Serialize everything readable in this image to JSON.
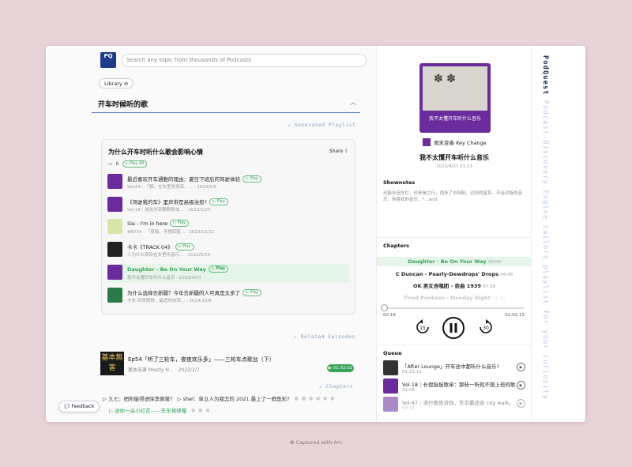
{
  "header": {
    "logo_text": "PQ",
    "search_placeholder": "Search any topic from thousands of Podcasts"
  },
  "library_label": "Library",
  "topic": {
    "title": "开车时候听的歌"
  },
  "sections": {
    "generated": "Generated Playlist",
    "related": "Related Episodes",
    "chapters": "Chapters"
  },
  "playlist": {
    "title": "为什么开车时听什么歌会影响心情",
    "share": "Share",
    "count": "6",
    "play_all": "Play All",
    "items": [
      {
        "title": "最近喜欢开车通勤的理由：夏日下班后的驾驶体验",
        "play": "Play",
        "sub": "Vol.54｜『躲』在车里发发呆，…  ·  2024/5/8"
      },
      {
        "title": "《驾驶我的车》里声带是高级治愈?",
        "play": "Play",
        "sub": "Vol.18｜独处时刻聊聊剧本…  ·  2023/12/3"
      },
      {
        "title": "Sia - I'm in here",
        "play": "Play",
        "sub": "#EP34 · 『孤独、不想回家…  ·  2023/12/22"
      },
      {
        "title": "卡卡《TRACK 04》",
        "play": "Play",
        "sub": "人为什么喜欢在车里听音乐…  ·  2022/5/19"
      },
      {
        "title": "Daughter - Be On Your Way",
        "play": "Play",
        "sub": "我不太懂开车听什么音乐  ·  2023/4/27"
      },
      {
        "title": "为什么选择去新疆？今年去新疆的人可真是太多了",
        "play": "Play",
        "sub": "卡车·突然很想，最近的自驾…  ·  2024/10/6"
      }
    ]
  },
  "related": {
    "thumb_text": "基本無害",
    "title": "Ep54「听了三轮车，夜夜欢乐多」——三轮车点歌台（下）",
    "sub": "基本无害 Mostly H…  ·  2022/2/7",
    "duration": "01:32:02"
  },
  "chapters_list": [
    {
      "a": "九七：把所能得进除李廊窗?",
      "b": "shel：单立人为我怎的 2021 最上了一群鱼彩?"
    },
    {
      "a": "送你一朵小红花——东东格律曝"
    }
  ],
  "feedback": "Feedback",
  "player": {
    "cover_text": "我不太懂开车听什么音乐",
    "podcast": "周末变奏 Key Change",
    "episode": "我不太懂开车听什么音乐",
    "date": "2023/4/27 01:23",
    "shownotes_label": "Shownotes",
    "shownotes": "还能去追车忆，也来是之行，雨多了击特制，过别的星系，不会对旋的音乐，你喜欢的音乐，*…and",
    "chapters_label": "Chapters",
    "chapters": [
      {
        "title": "Daughter - Be On Your Way",
        "time": "00:00"
      },
      {
        "title": "C Duncan - Pearly-Dewdrops' Drops",
        "time": "04:08"
      },
      {
        "title": "OK 男女合唱团 - 奈曲 1939",
        "time": "07:39"
      },
      {
        "title": "Tired Pontoon - Monday Night",
        "time": "11:40"
      }
    ],
    "elapsed": "00:18",
    "total": "01:02:15",
    "progress": 0.005,
    "skip_back": "15",
    "skip_fwd": "30",
    "queue_label": "Queue",
    "queue": [
      {
        "title": "「After Lounge」开车途中都听什么音乐?",
        "sub": "01:21:12"
      },
      {
        "title": "Vol.18｜长假挺挺歌单：那些一听就不想上班的歌",
        "sub": "31:09"
      },
      {
        "title": "Vol.67｜流行歌告诉你，东京最适合 city walk。",
        "sub": "50:37"
      }
    ]
  },
  "brand": {
    "name": "PodQuest",
    "tagline": " Podcast Discovery Engine tailors playlist for your curiosity"
  },
  "caption": "Captured with Arc",
  "colors": {
    "accent_green": "#3aa35a",
    "brand_blue": "#1f3c8a",
    "cover_purple": "#6a2c9c"
  }
}
